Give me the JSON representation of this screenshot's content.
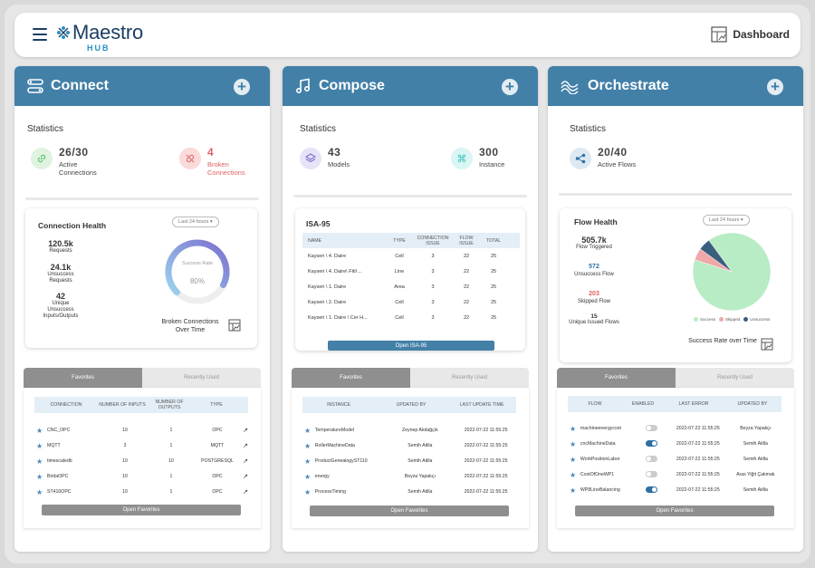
{
  "header": {
    "logo": "Maestro",
    "logo_sub": "HUB",
    "dashboard": "Dashboard"
  },
  "connect": {
    "title": "Connect",
    "stats_label": "Statistics",
    "active_value": "26/30",
    "active_label": "Active Connections",
    "broken_value": "4",
    "broken_label": "Broken Connections",
    "health": {
      "title": "Connection Health",
      "range": "Last 24 hours",
      "requests_v": "120.5k",
      "requests_l": "Requests",
      "unsuccess_v": "24.1k",
      "unsuccess_l": "Unsuccess Requests",
      "unique_v": "42",
      "unique_l": "Unique Unsuccess Inputs/Outputs",
      "gauge_label": "Success Rate",
      "gauge_value": "80%",
      "gauge_fraction": 0.8,
      "link": "Broken Connections Over Time"
    },
    "tabs": [
      "Favorites",
      "Recently Used"
    ],
    "columns": [
      "CONNECTION",
      "NUMBER OF INPUTS",
      "NUMBER OF OUTPUTS",
      "TYPE"
    ],
    "rows": [
      [
        "CNC_OPC",
        "10",
        "1",
        "OPC"
      ],
      [
        "MQTT",
        "3",
        "1",
        "MQTT"
      ],
      [
        "timescaledb",
        "10",
        "10",
        "POSTGRESQL"
      ],
      [
        "BridaOPC",
        "10",
        "1",
        "OPC"
      ],
      [
        "ST410OPC",
        "10",
        "1",
        "OPC"
      ]
    ],
    "open": "Open Favorites"
  },
  "compose": {
    "title": "Compose",
    "stats_label": "Statistics",
    "models_value": "43",
    "models_label": "Models",
    "instance_value": "300",
    "instance_label": "Instance",
    "isa": {
      "title": "ISA-95",
      "columns": [
        "NAME",
        "TYPE",
        "CONNECTION ISSUE",
        "FLOW ISSUE",
        "TOTAL"
      ],
      "rows": [
        [
          "Kayseri \\ 4. Daire",
          "Cell",
          "3",
          "22",
          "25"
        ],
        [
          "Kayseri \\ 4. Daire\\ Fitil ...",
          "Line",
          "3",
          "22",
          "25"
        ],
        [
          "Kayseri \\ 1. Daire",
          "Area",
          "3",
          "22",
          "25"
        ],
        [
          "Kayseri \\ 2. Daire",
          "Cell",
          "3",
          "22",
          "25"
        ],
        [
          "Kayseri \\ 1. Daire \\ Cer H...",
          "Cell",
          "3",
          "22",
          "25"
        ]
      ],
      "open": "Open ISA-95"
    },
    "tabs": [
      "Favorites",
      "Recently Used"
    ],
    "columns": [
      "INSTANCE",
      "UPDATED BY",
      "LAST UPDATE TIME"
    ],
    "rows": [
      [
        "TemperatureModel",
        "Zeynep Akdağçık",
        "2022-07-22 11:55:25"
      ],
      [
        "RollerMachineData",
        "Semih Atilla",
        "2022-07-22 11:55:25"
      ],
      [
        "ProductGenealogyST110",
        "Semih Atilla",
        "2022-07-22 11:55:25"
      ],
      [
        "energy",
        "Beyza Yapakçı",
        "2022-07-22 11:55:25"
      ],
      [
        "ProcessTiming",
        "Semih Atilla",
        "2022-07-22 11:55:25"
      ]
    ],
    "open": "Open Favorites"
  },
  "orchestrate": {
    "title": "Orchestrate",
    "stats_label": "Statistics",
    "flows_value": "20/40",
    "flows_label": "Active Flows",
    "health": {
      "title": "Flow Health",
      "range": "Last 24 hours",
      "trig_v": "505.7k",
      "trig_l": "Flow Triggered",
      "unsucc_v": "572",
      "unsucc_l": "Unsuccess Flow",
      "skip_v": "203",
      "skip_l": "Skipped Flow",
      "uniq_v": "15",
      "uniq_l": "Unique Issued Flows",
      "link": "Success Rate over Time",
      "legend": [
        "Success",
        "Skipped",
        "Unsuccess"
      ],
      "pie": [
        0.9,
        0.05,
        0.05
      ],
      "colors": [
        "#b8ecc4",
        "#f0a8a8",
        "#3a5e7e"
      ]
    },
    "tabs": [
      "Favorites",
      "Recently Used"
    ],
    "columns": [
      "FLOW",
      "ENABLED",
      "LAST ERROR",
      "UPDATED BY"
    ],
    "rows": [
      [
        "machineenergycost",
        "off",
        "2022-07-22 11:55:25",
        "Beyza Yapakçı"
      ],
      [
        "cncMachineData",
        "on",
        "2022-07-22 11:55:25",
        "Semih Atilla"
      ],
      [
        "WorkPositionLabor",
        "off",
        "2022-07-22 11:55:25",
        "Semih Atilla"
      ],
      [
        "CostOfOneWP1",
        "off",
        "2022-07-22 11:55:25",
        "Aras Yiğit Çakmak"
      ],
      [
        "WP8LineBalancing",
        "on",
        "2022-07-22 11:55:25",
        "Semih Atilla"
      ]
    ],
    "open": "Open Favorites"
  }
}
